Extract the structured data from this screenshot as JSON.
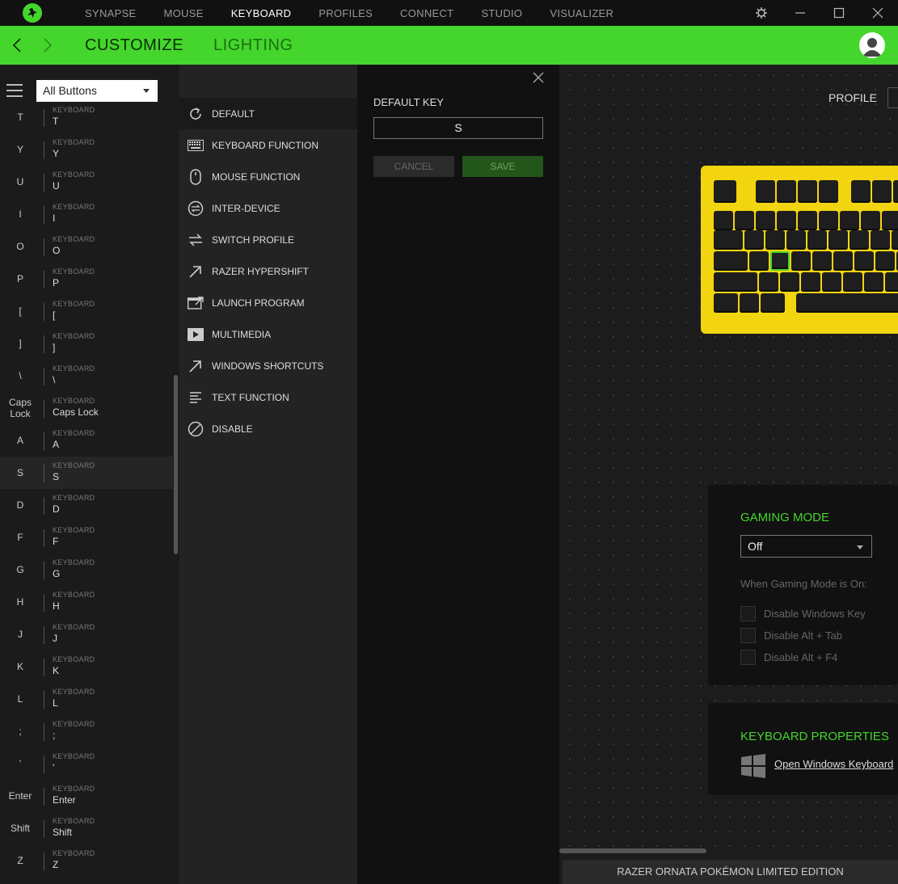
{
  "nav": {
    "tabs": [
      "SYNAPSE",
      "MOUSE",
      "KEYBOARD",
      "PROFILES",
      "CONNECT",
      "STUDIO",
      "VISUALIZER"
    ],
    "active": "KEYBOARD"
  },
  "subnav": {
    "customize": "CUSTOMIZE",
    "lighting": "LIGHTING"
  },
  "left": {
    "filter": "All Buttons",
    "type_label": "KEYBOARD",
    "keys": [
      {
        "name": "T",
        "value": "T"
      },
      {
        "name": "Y",
        "value": "Y"
      },
      {
        "name": "U",
        "value": "U"
      },
      {
        "name": "I",
        "value": "I"
      },
      {
        "name": "O",
        "value": "O"
      },
      {
        "name": "P",
        "value": "P"
      },
      {
        "name": "[",
        "value": "["
      },
      {
        "name": "]",
        "value": "]"
      },
      {
        "name": "\\",
        "value": "\\"
      },
      {
        "name": "Caps Lock",
        "value": "Caps Lock"
      },
      {
        "name": "A",
        "value": "A"
      },
      {
        "name": "S",
        "value": "S"
      },
      {
        "name": "D",
        "value": "D"
      },
      {
        "name": "F",
        "value": "F"
      },
      {
        "name": "G",
        "value": "G"
      },
      {
        "name": "H",
        "value": "H"
      },
      {
        "name": "J",
        "value": "J"
      },
      {
        "name": "K",
        "value": "K"
      },
      {
        "name": "L",
        "value": "L"
      },
      {
        "name": ";",
        "value": ";"
      },
      {
        "name": "'",
        "value": "'"
      },
      {
        "name": "Enter",
        "value": "Enter"
      },
      {
        "name": "Shift",
        "value": "Shift"
      },
      {
        "name": "Z",
        "value": "Z"
      }
    ],
    "selected": "S"
  },
  "functions": [
    {
      "label": "DEFAULT",
      "icon": "refresh-icon"
    },
    {
      "label": "KEYBOARD FUNCTION",
      "icon": "keyboard-icon"
    },
    {
      "label": "MOUSE FUNCTION",
      "icon": "mouse-icon"
    },
    {
      "label": "INTER-DEVICE",
      "icon": "inter-device-icon"
    },
    {
      "label": "SWITCH PROFILE",
      "icon": "switch-arrows-icon"
    },
    {
      "label": "RAZER HYPERSHIFT",
      "icon": "diagonal-arrow-icon"
    },
    {
      "label": "LAUNCH PROGRAM",
      "icon": "launch-window-icon"
    },
    {
      "label": "MULTIMEDIA",
      "icon": "play-icon"
    },
    {
      "label": "WINDOWS SHORTCUTS",
      "icon": "diagonal-arrow-icon"
    },
    {
      "label": "TEXT FUNCTION",
      "icon": "text-lines-icon"
    },
    {
      "label": "DISABLE",
      "icon": "disable-icon"
    }
  ],
  "detail": {
    "title": "DEFAULT KEY",
    "value": "S",
    "cancel": "CANCEL",
    "save": "SAVE"
  },
  "main": {
    "profile_label": "PROFILE",
    "gaming_mode": {
      "title": "GAMING MODE",
      "value": "Off",
      "note": "When Gaming Mode is On:",
      "options": [
        "Disable Windows Key",
        "Disable Alt + Tab",
        "Disable Alt + F4"
      ]
    },
    "keyboard_properties": {
      "title": "KEYBOARD PROPERTIES",
      "link": "Open Windows Keyboard"
    },
    "device_name": "RAZER ORNATA POKÉMON LIMITED EDITION"
  },
  "colors": {
    "accent": "#44d62c",
    "keyboard_body": "#f2d50f"
  }
}
